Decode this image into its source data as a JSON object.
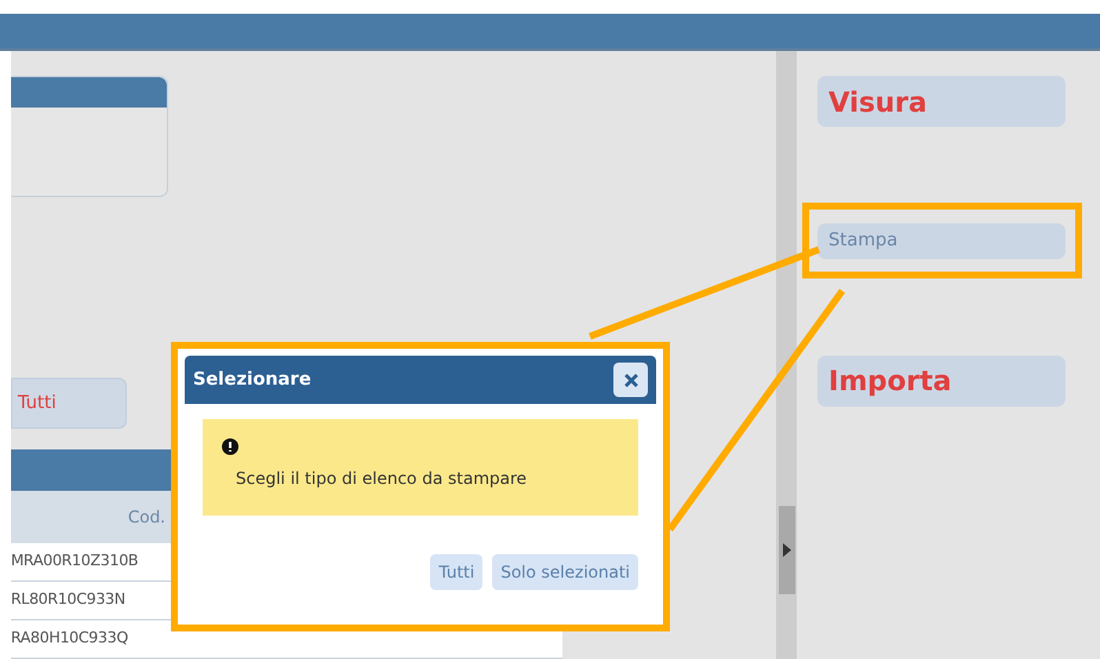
{
  "left_panel": {
    "filter_button": {
      "label": "Tutti"
    },
    "table": {
      "columns": [
        "Cod."
      ],
      "rows": [
        {
          "code": "MRA00R10Z310B"
        },
        {
          "code": "RL80R10C933N"
        },
        {
          "code": "RA80H10C933Q"
        }
      ]
    }
  },
  "right_panel": {
    "actions": [
      {
        "label": "Visura",
        "kind": "large",
        "highlighted": false
      },
      {
        "label": "Stampa",
        "kind": "small",
        "highlighted": true
      },
      {
        "label": "Importa",
        "kind": "large",
        "highlighted": false
      }
    ]
  },
  "dialog": {
    "title": "Selezionare",
    "message": "Scegli il tipo di elenco da stampare",
    "buttons": [
      "Tutti",
      "Solo selezionati"
    ],
    "highlighted": true
  }
}
